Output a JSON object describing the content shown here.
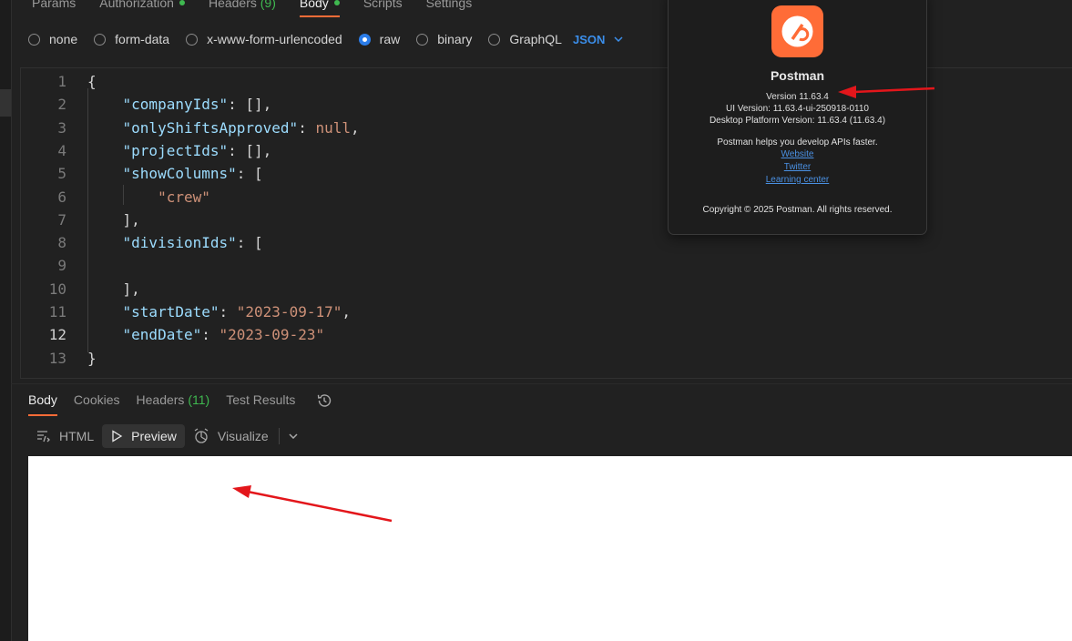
{
  "request_tabs": [
    {
      "label": "Params"
    },
    {
      "label": "Authorization"
    },
    {
      "label": "Headers",
      "count": "(9)"
    },
    {
      "label": "Body"
    },
    {
      "label": "Scripts"
    },
    {
      "label": "Settings"
    }
  ],
  "body_types": [
    {
      "label": "none",
      "checked": false
    },
    {
      "label": "form-data",
      "checked": false
    },
    {
      "label": "x-www-form-urlencoded",
      "checked": false
    },
    {
      "label": "raw",
      "checked": true
    },
    {
      "label": "binary",
      "checked": false
    },
    {
      "label": "GraphQL",
      "checked": false
    }
  ],
  "format": "JSON",
  "editor": {
    "current_line": 12,
    "lines": [
      [
        {
          "t": "{",
          "c": "p"
        }
      ],
      [
        {
          "t": "    ",
          "c": "p"
        },
        {
          "t": "\"companyIds\"",
          "c": "k"
        },
        {
          "t": ": [],",
          "c": "p"
        }
      ],
      [
        {
          "t": "    ",
          "c": "p"
        },
        {
          "t": "\"onlyShiftsApproved\"",
          "c": "k"
        },
        {
          "t": ": ",
          "c": "p"
        },
        {
          "t": "null",
          "c": "kw"
        },
        {
          "t": ",",
          "c": "p"
        }
      ],
      [
        {
          "t": "    ",
          "c": "p"
        },
        {
          "t": "\"projectIds\"",
          "c": "k"
        },
        {
          "t": ": [],",
          "c": "p"
        }
      ],
      [
        {
          "t": "    ",
          "c": "p"
        },
        {
          "t": "\"showColumns\"",
          "c": "k"
        },
        {
          "t": ": [",
          "c": "p"
        }
      ],
      [
        {
          "t": "        ",
          "c": "p"
        },
        {
          "t": "\"crew\"",
          "c": "s"
        }
      ],
      [
        {
          "t": "    ],",
          "c": "p"
        }
      ],
      [
        {
          "t": "    ",
          "c": "p"
        },
        {
          "t": "\"divisionIds\"",
          "c": "k"
        },
        {
          "t": ": [",
          "c": "p"
        }
      ],
      [
        {
          "t": "",
          "c": "p"
        }
      ],
      [
        {
          "t": "    ],",
          "c": "p"
        }
      ],
      [
        {
          "t": "    ",
          "c": "p"
        },
        {
          "t": "\"startDate\"",
          "c": "k"
        },
        {
          "t": ": ",
          "c": "p"
        },
        {
          "t": "\"2023-09-17\"",
          "c": "s"
        },
        {
          "t": ",",
          "c": "p"
        }
      ],
      [
        {
          "t": "    ",
          "c": "p"
        },
        {
          "t": "\"endDate\"",
          "c": "k"
        },
        {
          "t": ": ",
          "c": "p"
        },
        {
          "t": "\"2023-09-23\"",
          "c": "s"
        }
      ],
      [
        {
          "t": "}",
          "c": "p"
        }
      ]
    ]
  },
  "response_tabs": [
    {
      "label": "Body"
    },
    {
      "label": "Cookies"
    },
    {
      "label": "Headers",
      "count": "(11)"
    },
    {
      "label": "Test Results"
    }
  ],
  "view_modes": {
    "html": "HTML",
    "preview": "Preview",
    "visualize": "Visualize"
  },
  "about": {
    "app_name": "Postman",
    "version": "Version 11.63.4",
    "ui_version": "UI Version: 11.63.4-ui-250918-0110",
    "desktop_version": "Desktop Platform Version: 11.63.4 (11.63.4)",
    "tagline": "Postman helps you develop APIs faster.",
    "links": [
      "Website",
      "Twitter",
      "Learning center"
    ],
    "copyright": "Copyright © 2025 Postman. All rights reserved."
  },
  "colors": {
    "accent": "#ff6c37",
    "link": "#3b8eea",
    "annotation_arrow": "#e3161b",
    "success": "#3fb950"
  }
}
